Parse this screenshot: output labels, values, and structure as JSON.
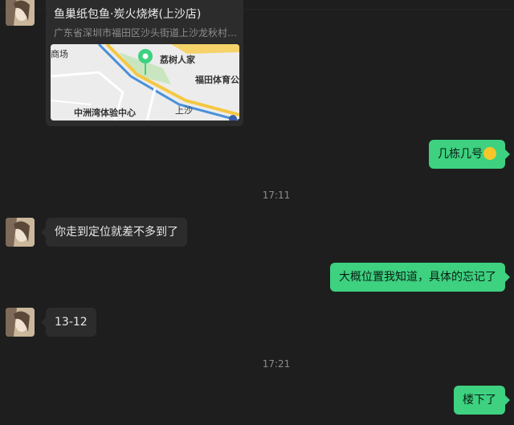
{
  "location_card": {
    "title": "鱼巢纸包鱼·炭火烧烤(上沙店)",
    "address": "广东省深圳市福田区沙头街道上沙龙秋村…",
    "map_labels": {
      "market": "商场",
      "lizhi": "荔树人家",
      "stadium": "福田体育公",
      "zhongzhou": "中洲湾体验中心",
      "shangsha": "上沙"
    }
  },
  "messages": {
    "m1": "几栋几号",
    "time1": "17:11",
    "m2": "你走到定位就差不多到了",
    "m3": "大概位置我知道，具体的忘记了",
    "m4": "13-12",
    "time2": "17:21",
    "m5": "楼下了"
  },
  "colors": {
    "background": "#1e1e1e",
    "bubble_in": "#2c2c2c",
    "bubble_out": "#3dd180",
    "timestamp": "#8c8c8c"
  }
}
